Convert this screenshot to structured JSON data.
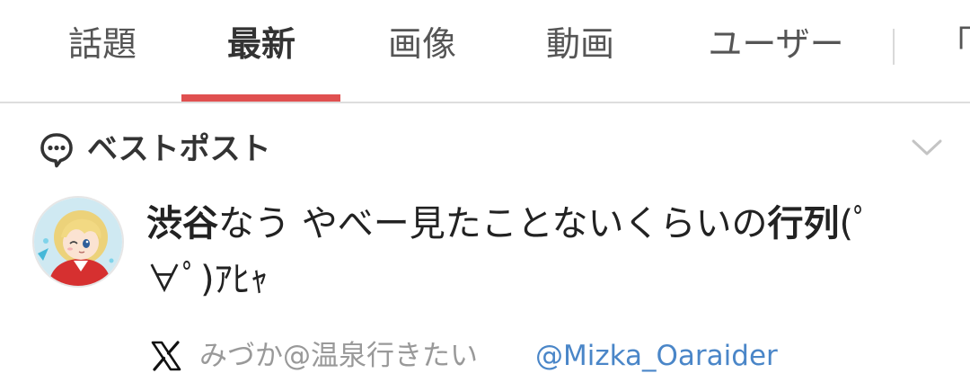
{
  "tabs": [
    {
      "label": "話題",
      "active": false
    },
    {
      "label": "最新",
      "active": true
    },
    {
      "label": "画像",
      "active": false
    },
    {
      "label": "動画",
      "active": false
    },
    {
      "label": "ユーザー",
      "active": false
    },
    {
      "label": "「",
      "active": false
    }
  ],
  "section": {
    "title": "ベストポスト",
    "icon": "speech-bubble-icon",
    "collapse_icon": "chevron-down-icon"
  },
  "post": {
    "text_parts": [
      {
        "text": "渋谷",
        "bold": true
      },
      {
        "text": "なう やべー見たことないくらいの",
        "bold": false
      },
      {
        "text": "行列",
        "bold": true
      },
      {
        "text": "(ﾟ∀ﾟ)ｱﾋｬ",
        "bold": false
      }
    ],
    "avatar": "user-avatar",
    "source_icon": "x-logo-icon",
    "author_name": "みづか@温泉行きたい",
    "author_handle": "@Mizka_Oaraider"
  },
  "colors": {
    "active_tab_indicator": "#e05050",
    "handle_link": "#4a86c8",
    "muted_text": "#999999"
  }
}
